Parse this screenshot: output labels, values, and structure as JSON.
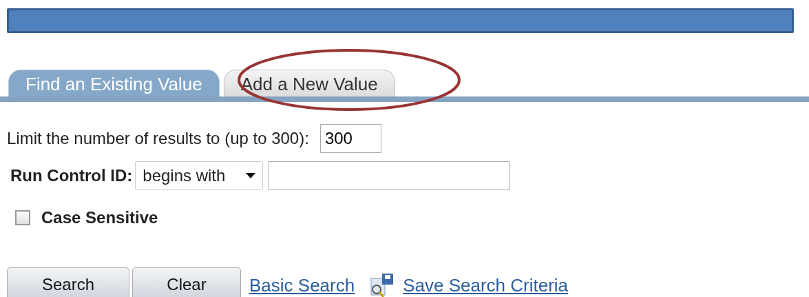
{
  "tabs": [
    {
      "label": "Find an Existing Value",
      "selected": true
    },
    {
      "label": "Add a New Value",
      "selected": false
    }
  ],
  "annotation": {
    "kind": "ellipse"
  },
  "limit": {
    "label": "Limit the number of results to (up to 300):",
    "value": "300"
  },
  "run_control": {
    "label": "Run Control ID:",
    "operator": "begins with"
  },
  "case_sensitive": {
    "label": "Case Sensitive",
    "checked": false
  },
  "buttons": [
    "Search",
    "Clear"
  ],
  "links": [
    {
      "label": "Basic Search",
      "kind": "plain"
    },
    {
      "label": "Save Search Criteria",
      "kind": "icon"
    }
  ]
}
